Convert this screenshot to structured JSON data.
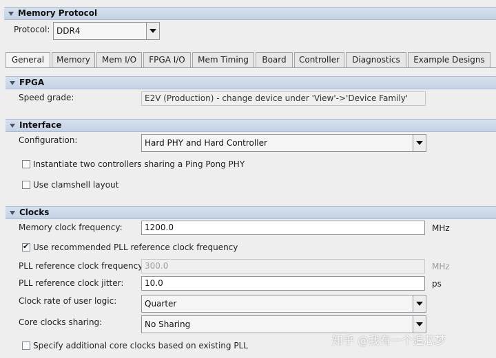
{
  "header": {
    "title": "Memory Protocol"
  },
  "protocol": {
    "label": "Protocol:",
    "value": "DDR4"
  },
  "tabs": [
    {
      "label": "General"
    },
    {
      "label": "Memory"
    },
    {
      "label": "Mem I/O"
    },
    {
      "label": "FPGA I/O"
    },
    {
      "label": "Mem Timing"
    },
    {
      "label": "Board"
    },
    {
      "label": "Controller"
    },
    {
      "label": "Diagnostics"
    },
    {
      "label": "Example Designs"
    }
  ],
  "fpga": {
    "title": "FPGA",
    "speed_grade_label": "Speed grade:",
    "speed_grade_value": "E2V (Production) - change device under 'View'->'Device Family'"
  },
  "interface": {
    "title": "Interface",
    "configuration_label": "Configuration:",
    "configuration_value": "Hard PHY and Hard Controller",
    "ping_pong_label": "Instantiate two controllers sharing a Ping Pong PHY",
    "ping_pong_checked": false,
    "clamshell_label": "Use clamshell layout",
    "clamshell_checked": false
  },
  "clocks": {
    "title": "Clocks",
    "mem_clock_label": "Memory clock frequency:",
    "mem_clock_value": "1200.0",
    "mem_clock_unit": "MHz",
    "use_recommended_label": "Use recommended PLL reference clock frequency",
    "use_recommended_checked": true,
    "pll_ref_label": "PLL reference clock frequency:",
    "pll_ref_value": "300.0",
    "pll_ref_unit": "MHz",
    "pll_jitter_label": "PLL reference clock jitter:",
    "pll_jitter_value": "10.0",
    "pll_jitter_unit": "ps",
    "user_logic_label": "Clock rate of user logic:",
    "user_logic_value": "Quarter",
    "core_sharing_label": "Core clocks sharing:",
    "core_sharing_value": "No Sharing",
    "additional_label": "Specify additional core clocks based on existing PLL",
    "additional_checked": false
  },
  "watermark": "知乎 @我有一个追芯梦"
}
